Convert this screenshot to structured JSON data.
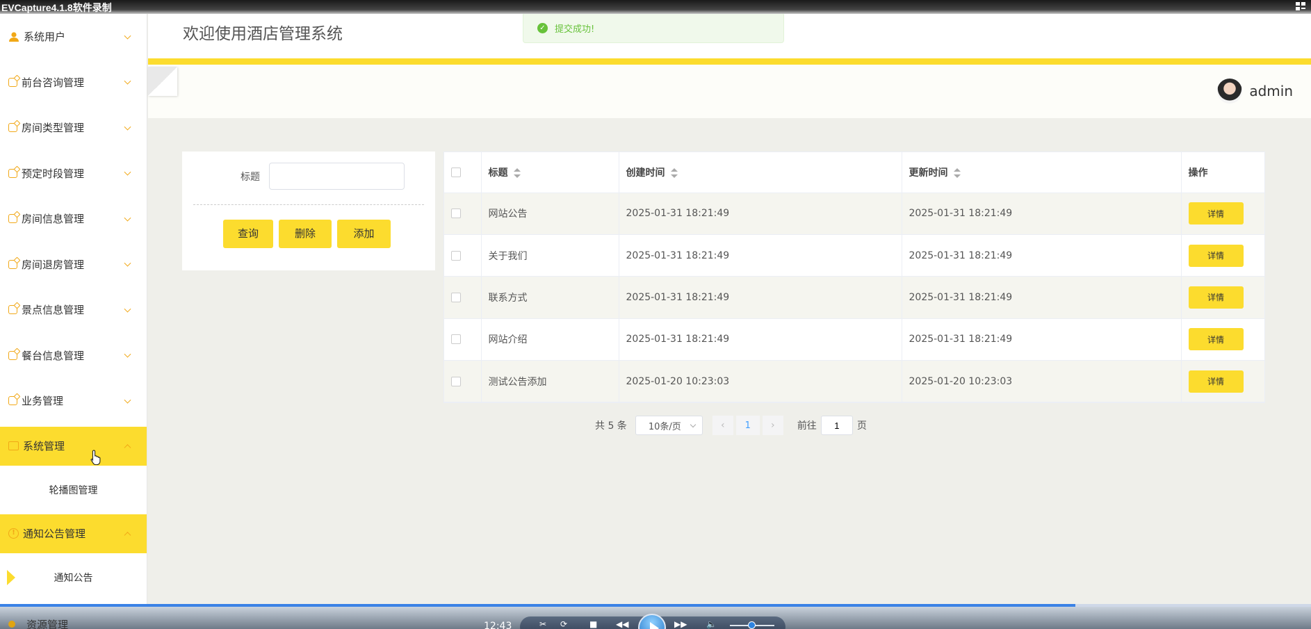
{
  "recorder": {
    "title": "EVCapture4.1.8软件录制",
    "time": "12:43",
    "progress": 0.82
  },
  "sidebar": {
    "items": [
      {
        "label": "系统用户",
        "icon": "user-icon"
      },
      {
        "label": "前台咨询管理",
        "icon": "edit-icon"
      },
      {
        "label": "房间类型管理",
        "icon": "edit-icon"
      },
      {
        "label": "预定时段管理",
        "icon": "edit-icon"
      },
      {
        "label": "房间信息管理",
        "icon": "edit-icon"
      },
      {
        "label": "房间退房管理",
        "icon": "edit-icon"
      },
      {
        "label": "景点信息管理",
        "icon": "edit-icon"
      },
      {
        "label": "餐台信息管理",
        "icon": "edit-icon"
      },
      {
        "label": "业务管理",
        "icon": "edit-icon"
      }
    ],
    "system_mgmt": {
      "label": "系统管理",
      "sub": "轮播图管理"
    },
    "notice_mgmt": {
      "label": "通知公告管理",
      "sub": "通知公告"
    },
    "resource_mgmt": {
      "label": "资源管理"
    }
  },
  "header": {
    "welcome": "欢迎使用酒店管理系统",
    "username": "admin"
  },
  "toast": {
    "message": "提交成功!"
  },
  "search": {
    "label": "标题",
    "value": "",
    "query_label": "查询",
    "delete_label": "删除",
    "add_label": "添加"
  },
  "table": {
    "headers": {
      "title": "标题",
      "created": "创建时间",
      "updated": "更新时间",
      "actions": "操作"
    },
    "detail_label": "详情",
    "rows": [
      {
        "title": "网站公告",
        "created": "2025-01-31 18:21:49",
        "updated": "2025-01-31 18:21:49"
      },
      {
        "title": "关于我们",
        "created": "2025-01-31 18:21:49",
        "updated": "2025-01-31 18:21:49"
      },
      {
        "title": "联系方式",
        "created": "2025-01-31 18:21:49",
        "updated": "2025-01-31 18:21:49"
      },
      {
        "title": "网站介绍",
        "created": "2025-01-31 18:21:49",
        "updated": "2025-01-31 18:21:49"
      },
      {
        "title": "测试公告添加",
        "created": "2025-01-20 10:23:03",
        "updated": "2025-01-20 10:23:03"
      }
    ]
  },
  "pagination": {
    "total": "共 5 条",
    "page_size": "10条/页",
    "current": "1",
    "goto_prefix": "前往",
    "goto_value": "1",
    "goto_suffix": "页"
  },
  "colors": {
    "accent": "#fcdc2e",
    "success": "#67c23a",
    "icon": "#f1a817"
  }
}
